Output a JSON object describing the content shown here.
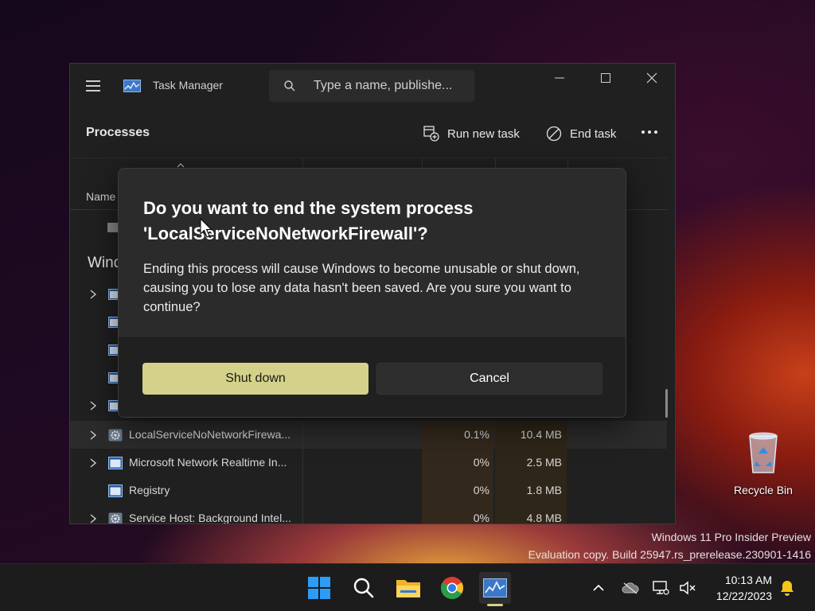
{
  "window": {
    "title": "Task Manager",
    "search_placeholder": "Type a name, publishe..."
  },
  "toolbar": {
    "heading": "Processes",
    "run_new_task": "Run new task",
    "end_task": "End task"
  },
  "table": {
    "col_name": "Name",
    "group_label_partial": "Wind",
    "rows": [
      {
        "name": "LocalServiceNoNetworkFirewa...",
        "cpu": "0.1%",
        "memory": "10.4 MB",
        "icon": "gear-icon",
        "expandable": true,
        "selected": true
      },
      {
        "name": "Microsoft Network Realtime In...",
        "cpu": "0%",
        "memory": "2.5 MB",
        "icon": "window-icon",
        "expandable": true,
        "selected": false
      },
      {
        "name": "Registry",
        "cpu": "0%",
        "memory": "1.8 MB",
        "icon": "window-icon",
        "expandable": false,
        "selected": false
      },
      {
        "name": "Service Host: Background Intel...",
        "cpu": "0%",
        "memory": "4.8 MB",
        "icon": "gear-icon",
        "expandable": true,
        "selected": false
      }
    ]
  },
  "dialog": {
    "title": "Do you want to end the system process 'LocalServiceNoNetworkFirewall'?",
    "body": "Ending this process will cause Windows to become unusable or shut down, causing you to lose any data hasn't been saved. Are you sure you want to continue?",
    "primary_button": "Shut down",
    "secondary_button": "Cancel",
    "accent_color": "#d4d28a"
  },
  "desktop": {
    "recycle_bin_label": "Recycle Bin",
    "watermark_line1": "Windows 11 Pro Insider Preview",
    "watermark_line2": "Evaluation copy. Build 25947.rs_prerelease.230901-1416"
  },
  "taskbar": {
    "time": "10:13 AM",
    "date": "12/22/2023",
    "apps": [
      "windows-start-icon",
      "search-icon",
      "file-explorer-icon",
      "chrome-icon",
      "task-manager-icon"
    ],
    "tray": [
      "chevron-up-icon",
      "onedrive-icon",
      "network-icon",
      "volume-muted-icon",
      "notification-bell-icon"
    ]
  }
}
